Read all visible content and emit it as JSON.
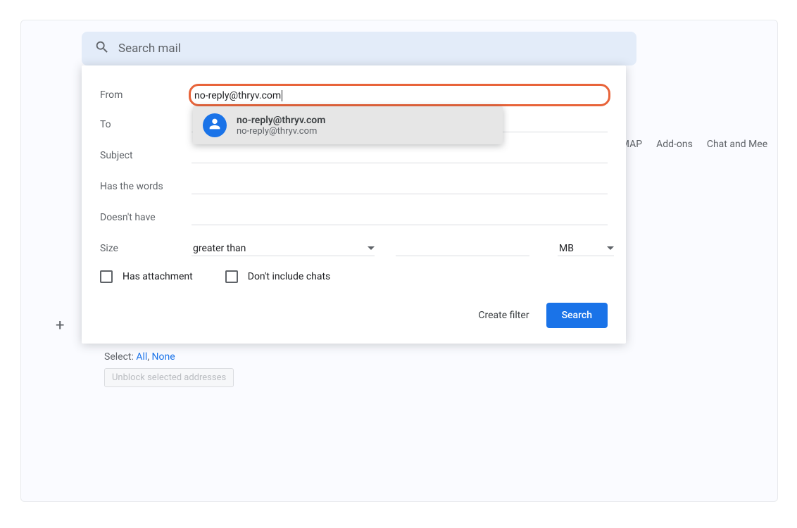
{
  "search": {
    "placeholder": "Search mail"
  },
  "filter": {
    "labels": {
      "from": "From",
      "to": "To",
      "subject": "Subject",
      "has_words": "Has the words",
      "doesnt_have": "Doesn't have",
      "size": "Size"
    },
    "from_value": "no-reply@thryv.com",
    "size_operator": "greater than",
    "size_unit": "MB",
    "checkboxes": {
      "has_attachment": "Has attachment",
      "dont_include_chats": "Don't include chats"
    },
    "actions": {
      "create_filter": "Create filter",
      "search": "Search"
    }
  },
  "suggestion": {
    "name": "no-reply@thryv.com",
    "email": "no-reply@thryv.com"
  },
  "tabs": {
    "imap": "IMAP",
    "addons": "Add-ons",
    "chat": "Chat and Mee"
  },
  "blocked": {
    "select_label": "Select:",
    "all": "All",
    "none": "None",
    "unblock": "Unblock selected addresses"
  }
}
